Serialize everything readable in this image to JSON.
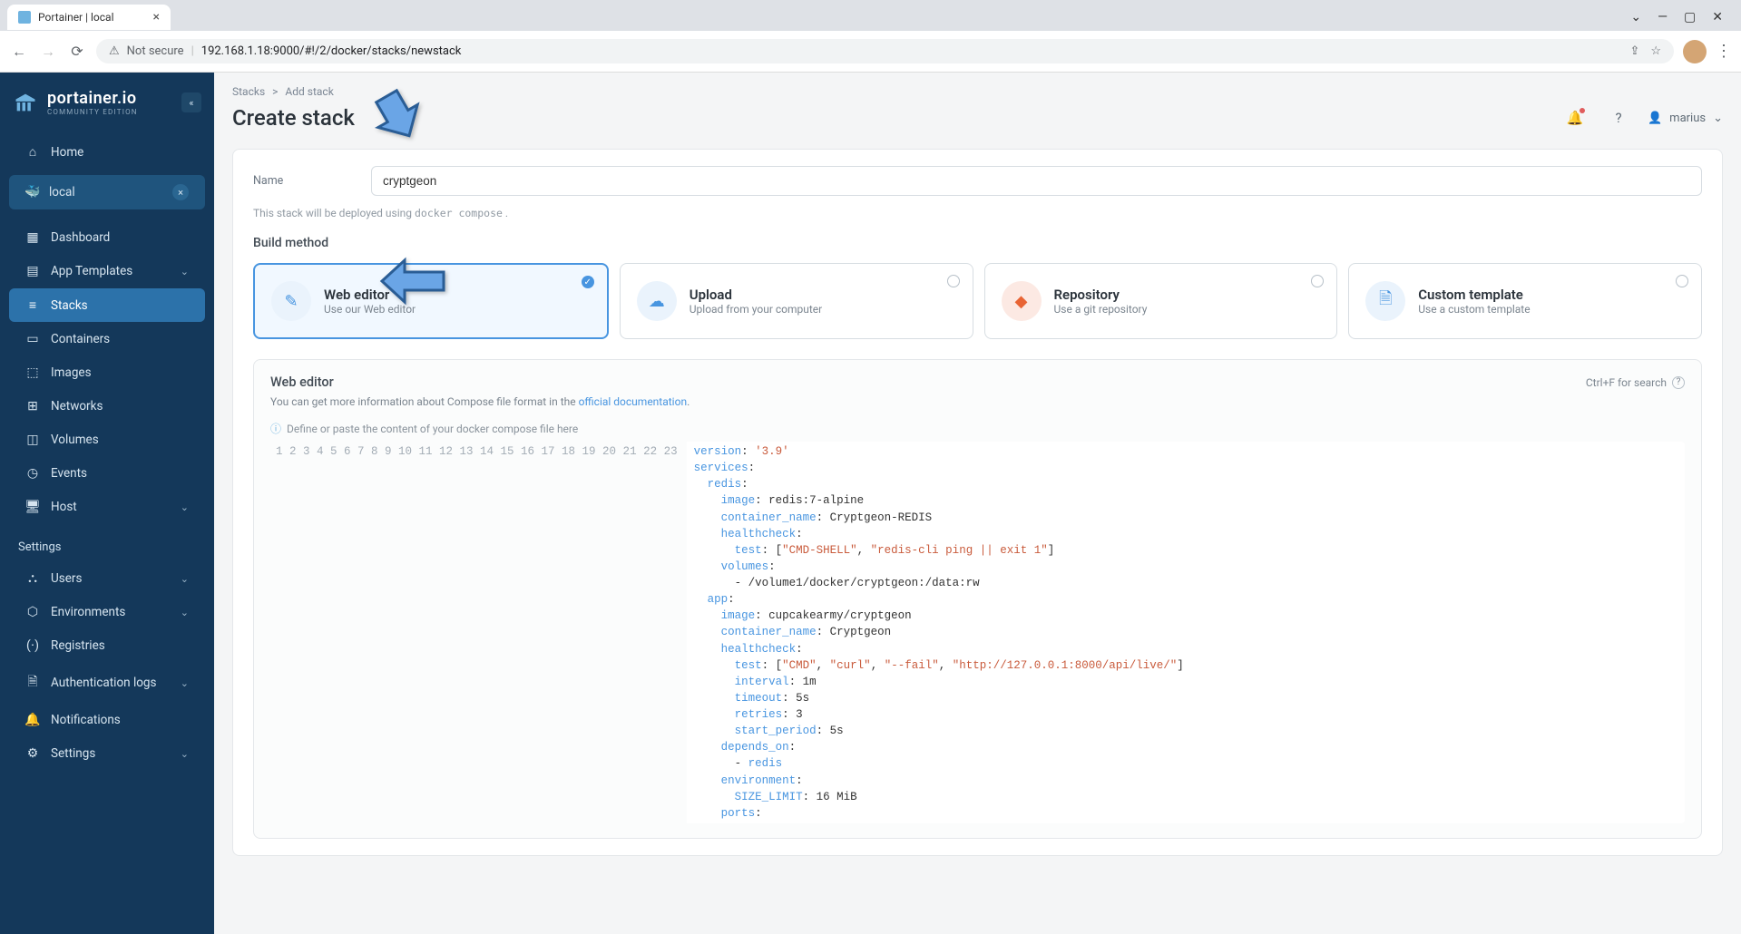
{
  "browser": {
    "tab_title": "Portainer | local",
    "not_secure": "Not secure",
    "url": "192.168.1.18:9000/#!/2/docker/stacks/newstack"
  },
  "brand": {
    "name": "portainer.io",
    "edition": "COMMUNITY EDITION"
  },
  "sidebar": {
    "home": "Home",
    "env_name": "local",
    "items": [
      {
        "icon": "grid",
        "label": "Dashboard"
      },
      {
        "icon": "template",
        "label": "App Templates",
        "expandable": true
      },
      {
        "icon": "stacks",
        "label": "Stacks",
        "active": true
      },
      {
        "icon": "containers",
        "label": "Containers"
      },
      {
        "icon": "images",
        "label": "Images"
      },
      {
        "icon": "networks",
        "label": "Networks"
      },
      {
        "icon": "volumes",
        "label": "Volumes"
      },
      {
        "icon": "events",
        "label": "Events"
      },
      {
        "icon": "host",
        "label": "Host",
        "expandable": true
      }
    ],
    "settings_label": "Settings",
    "settings": [
      {
        "icon": "users",
        "label": "Users",
        "expandable": true
      },
      {
        "icon": "env",
        "label": "Environments",
        "expandable": true
      },
      {
        "icon": "registries",
        "label": "Registries"
      },
      {
        "icon": "auth",
        "label": "Authentication logs",
        "expandable": true
      },
      {
        "icon": "bell",
        "label": "Notifications"
      },
      {
        "icon": "gear",
        "label": "Settings",
        "expandable": true
      }
    ]
  },
  "breadcrumb": {
    "root": "Stacks",
    "leaf": "Add stack"
  },
  "page_title": "Create stack",
  "user_name": "marius",
  "form": {
    "name_label": "Name",
    "name_value": "cryptgeon",
    "deploy_note_prefix": "This stack will be deployed using ",
    "deploy_note_code": "docker compose",
    "deploy_note_suffix": " ."
  },
  "build": {
    "heading": "Build method",
    "methods": [
      {
        "title": "Web editor",
        "sub": "Use our Web editor",
        "selected": true
      },
      {
        "title": "Upload",
        "sub": "Upload from your computer"
      },
      {
        "title": "Repository",
        "sub": "Use a git repository"
      },
      {
        "title": "Custom template",
        "sub": "Use a custom template"
      }
    ]
  },
  "editor": {
    "title": "Web editor",
    "search_hint": "Ctrl+F for search",
    "help_prefix": "You can get more information about Compose file format in the ",
    "help_link": "official documentation",
    "help_suffix": ".",
    "tip": "Define or paste the content of your docker compose file here",
    "lines": [
      "version: '3.9'",
      "services:",
      "  redis:",
      "    image: redis:7-alpine",
      "    container_name: Cryptgeon-REDIS",
      "    healthcheck:",
      "      test: [\"CMD-SHELL\", \"redis-cli ping || exit 1\"]",
      "    volumes:",
      "      - /volume1/docker/cryptgeon:/data:rw",
      "  app:",
      "    image: cupcakearmy/cryptgeon",
      "    container_name: Cryptgeon",
      "    healthcheck:",
      "      test: [\"CMD\", \"curl\", \"--fail\", \"http://127.0.0.1:8000/api/live/\"]",
      "      interval: 1m",
      "      timeout: 5s",
      "      retries: 3",
      "      start_period: 5s",
      "    depends_on:",
      "      - redis",
      "    environment:",
      "      SIZE_LIMIT: 16 MiB",
      "    ports:"
    ]
  }
}
